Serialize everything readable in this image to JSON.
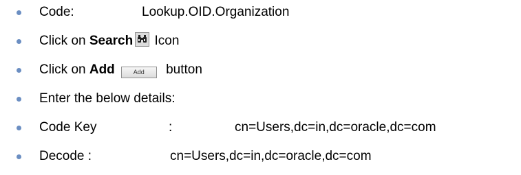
{
  "items": [
    {
      "label": "Code:",
      "value": "Lookup.OID.Organization"
    },
    {
      "prefix": "Click on ",
      "bold": "Search",
      "suffix": " Icon"
    },
    {
      "prefix": "Click on ",
      "bold": "Add",
      "button_label": "Add",
      "suffix": " button"
    },
    {
      "text": "Enter the below details:"
    },
    {
      "label": "Code Key",
      "separator": ":",
      "value": "cn=Users,dc=in,dc=oracle,dc=com"
    },
    {
      "label": "Decode :",
      "value": "cn=Users,dc=in,dc=oracle,dc=com"
    }
  ],
  "icons": {
    "bullet": "bullet-dot",
    "search": "binoculars-icon"
  },
  "colors": {
    "bullet": "#6b8ec2",
    "text": "#000000"
  }
}
